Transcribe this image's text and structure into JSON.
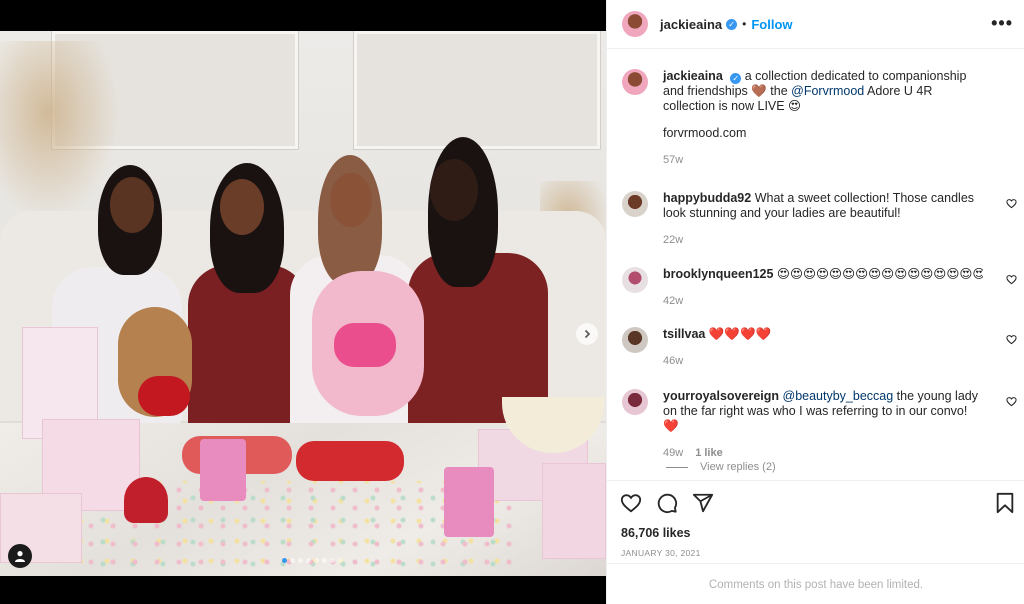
{
  "post": {
    "username": "jackieaina",
    "verified_mark": "✓",
    "dot": "•",
    "follow_label": "Follow",
    "more_label": "•••",
    "caption_text_1": " a collection dedicated to companionship and friendships 🤎 the ",
    "caption_mention": "@Forvrmood",
    "caption_text_2": " Adore U 4R collection is now LIVE 😍",
    "caption_link": "forvrmood.com",
    "caption_time": "57w",
    "likes": "86,706 likes",
    "date": "JANUARY 30, 2021",
    "comments_limited": "Comments on this post have been limited.",
    "carousel_total": 8,
    "carousel_active": 0
  },
  "comments": [
    {
      "username": "happybudda92",
      "text": " What a sweet collection! Those candles look stunning and your ladies are beautiful!",
      "time": "22w",
      "likes": ""
    },
    {
      "username": "brooklynqueen125",
      "text": " 😍😍😍😍😍😍😍😍😍😍😍😍😍😍😍😍😍😍😍😍😍",
      "time": "42w",
      "likes": ""
    },
    {
      "username": "tsillvaa",
      "text": " ❤️❤️❤️❤️",
      "time": "46w",
      "likes": ""
    },
    {
      "username": "yourroyalsovereign",
      "mention": "@beautyby_beccag",
      "text": " the young lady on the far right was who I was referring to in our convo! ❤️",
      "time": "49w",
      "likes": "1 like"
    }
  ],
  "view_replies": "View replies (2)",
  "icons": {
    "like": "heart-icon",
    "comment": "comment-icon",
    "share": "share-icon",
    "save": "bookmark-icon",
    "comment_like": "heart-outline-icon",
    "next": "chevron-right-icon",
    "tags": "user-tag-icon"
  },
  "colors": {
    "accent": "#0095f6",
    "verified": "#3897f0",
    "muted": "#8e8e8e"
  }
}
